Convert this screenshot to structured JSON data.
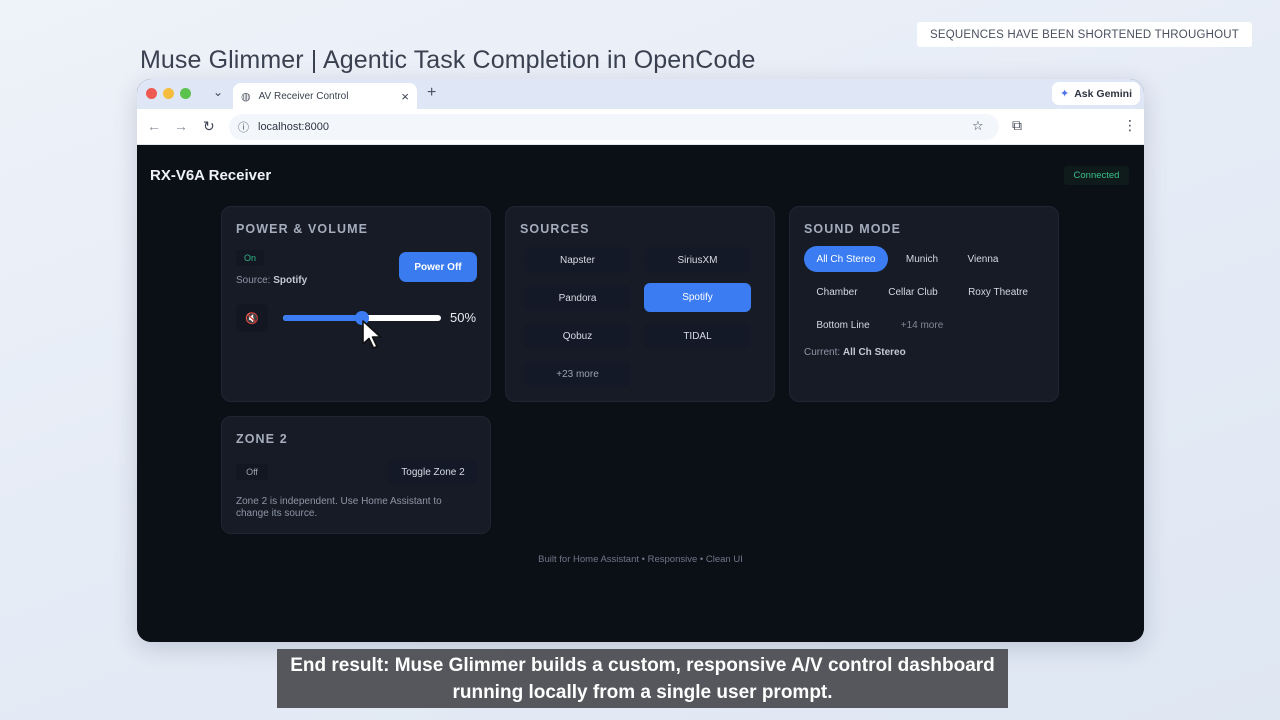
{
  "page": {
    "heading": "Muse Glimmer | Agentic Task Completion in OpenCode",
    "badge": "SEQUENCES HAVE BEEN SHORTENED THROUGHOUT",
    "caption_line1": "End result: Muse Glimmer builds a custom, responsive A/V control dashboard",
    "caption_line2": "running locally from a single user prompt."
  },
  "browser": {
    "tab_title": "AV Receiver Control",
    "url": "localhost:8000",
    "ask_gemini": "Ask Gemini"
  },
  "app": {
    "title": "RX-V6A Receiver",
    "status": "Connected",
    "footer": "Built for Home Assistant • Responsive • Clean UI"
  },
  "power": {
    "title": "POWER & VOLUME",
    "state": "On",
    "source_label": "Source:",
    "source_value": "Spotify",
    "power_button": "Power Off",
    "mute_icon": "🔇",
    "volume_percent": 50,
    "volume_text": "50%"
  },
  "sources": {
    "title": "SOURCES",
    "items": [
      "Napster",
      "SiriusXM",
      "Pandora",
      "Spotify",
      "Qobuz",
      "TIDAL",
      "+23 more"
    ],
    "active": "Spotify"
  },
  "sound": {
    "title": "SOUND MODE",
    "items": [
      "All Ch Stereo",
      "Munich",
      "Vienna",
      "Chamber",
      "Cellar Club",
      "Roxy Theatre",
      "Bottom Line",
      "+14 more"
    ],
    "active": "All Ch Stereo",
    "current_label": "Current:",
    "current_value": "All Ch Stereo"
  },
  "zone2": {
    "title": "ZONE 2",
    "state": "Off",
    "toggle_button": "Toggle Zone 2",
    "note": "Zone 2 is independent. Use Home Assistant to change its source."
  },
  "colors": {
    "accent": "#3b7cf2",
    "connected": "#37c08a",
    "app_background": "#0b0f16",
    "card_background": "#161b26"
  }
}
